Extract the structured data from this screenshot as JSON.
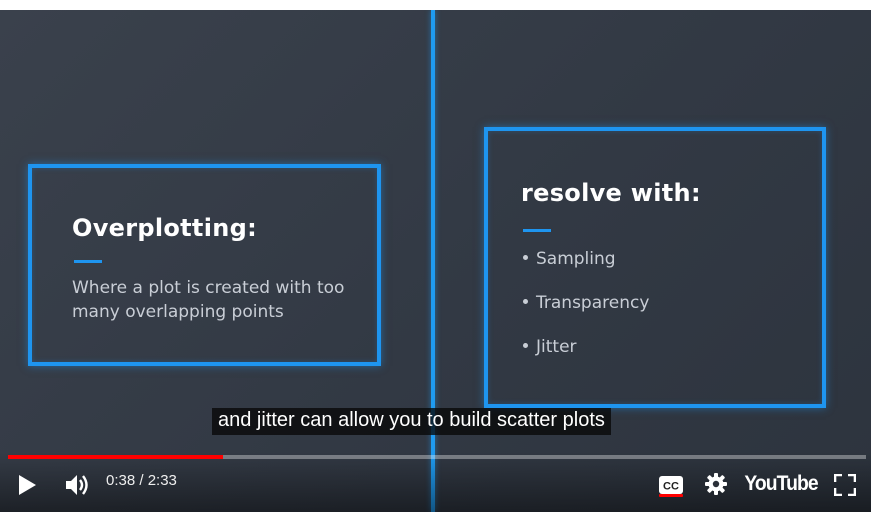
{
  "slide": {
    "left_card": {
      "title": "Overplotting:",
      "description": "Where a plot is created with too many overlapping points"
    },
    "right_card": {
      "title": "resolve with:",
      "bullets": [
        "Sampling",
        "Transparency",
        "Jitter"
      ]
    }
  },
  "caption": "and jitter can allow you to build scatter plots",
  "player": {
    "current_time": "0:38",
    "duration": "2:33",
    "time_display": "0:38 / 2:33",
    "progress_fraction": 0.25,
    "logo_text": "YouTube",
    "icons": {
      "play": "play-icon",
      "volume": "volume-icon",
      "cc": "closed-captions-icon",
      "settings": "gear-icon",
      "fullscreen": "fullscreen-icon"
    },
    "colors": {
      "progress": "#ff0000",
      "accent_blue": "#1e95f0"
    }
  }
}
